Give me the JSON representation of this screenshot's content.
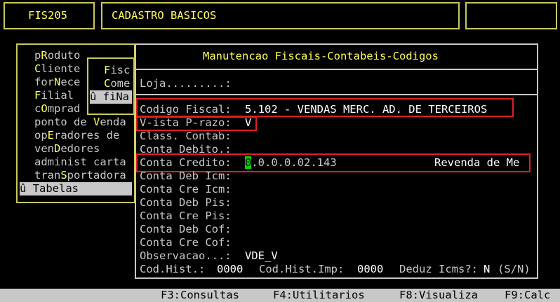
{
  "header": {
    "program_code": "FIS205",
    "module_title": "CADASTRO BASICOS"
  },
  "menu": {
    "items": [
      {
        "pre": "p",
        "hot": "R",
        "post": "oduto"
      },
      {
        "pre": "",
        "hot": "C",
        "post": "liente"
      },
      {
        "pre": "for",
        "hot": "N",
        "post": "ece"
      },
      {
        "pre": "",
        "hot": "F",
        "post": "ilial"
      },
      {
        "pre": "c",
        "hot": "O",
        "post": "mprad"
      },
      {
        "pre": "ponto de ",
        "hot": "V",
        "post": "enda"
      },
      {
        "pre": "op",
        "hot": "E",
        "post": "radores de"
      },
      {
        "pre": "ven",
        "hot": "D",
        "post": "edores"
      },
      {
        "pre": "administ carta",
        "hot": "",
        "post": ""
      },
      {
        "pre": "tran",
        "hot": "S",
        "post": "portadora"
      }
    ],
    "selected_item": "û Tabelas"
  },
  "submenu": {
    "items": [
      {
        "hot": "F",
        "post": "isc"
      },
      {
        "hot": "C",
        "post": "ome"
      }
    ],
    "selected_item": "û fiNa"
  },
  "form": {
    "title": "Manutencao Fiscais-Contabeis-Codigos",
    "loja": "Loja.........:",
    "codigo_fiscal_label": "Codigo Fiscal:",
    "codigo_fiscal_value": "5.102 - VENDAS MERC. AD. DE TERCEIROS",
    "vista_prazo_label": "V-ista P-razo:",
    "vista_prazo_value": "V",
    "class_contab": "Class. Contab:",
    "conta_debito": "Conta Debito.:",
    "conta_credito_label": "Conta Credito:",
    "conta_credito_cursor": "0",
    "conta_credito_rest": ".0.0.0.02.143",
    "conta_credito_desc": "Revenda de Me",
    "conta_deb_icm": "Conta Deb Icm:",
    "conta_cre_icm": "Conta Cre Icm:",
    "conta_deb_pis": "Conta Deb Pis:",
    "conta_cre_pis": "Conta Cre Pis:",
    "conta_deb_cof": "Conta Deb Cof:",
    "conta_cre_cof": "Conta Cre Cof:",
    "observacao_label": "Observacao...:",
    "observacao_value": "VDE_V",
    "cod_hist_label": "Cod.Hist.:",
    "cod_hist_value": "0000",
    "cod_hist_imp_label": "Cod.Hist.Imp:",
    "cod_hist_imp_value": "0000",
    "deduz_icms_label": "Deduz Icms?:",
    "deduz_icms_value": "N",
    "deduz_icms_hint": "(S/N)"
  },
  "statusbar": {
    "f3": "F3:Consultas",
    "f4": "F4:Utilitarios",
    "f8": "F8:Visualiza",
    "f9": "F9:Calc"
  }
}
